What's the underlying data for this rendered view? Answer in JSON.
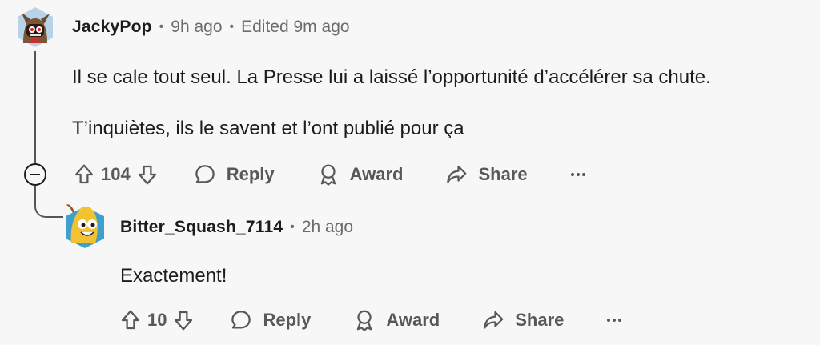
{
  "comments": [
    {
      "username": "JackyPop",
      "time": "9h ago",
      "edited": "Edited 9m ago",
      "body": [
        "Il se cale tout seul. La Presse lui a laissé l’opportunité d’accélérer sa chute.",
        "T’inquiètes, ils le savent et l’ont publié pour ça"
      ],
      "score": "104"
    },
    {
      "username": "Bitter_Squash_7114",
      "time": "2h ago",
      "body": [
        "Exactement!"
      ],
      "score": "10"
    }
  ],
  "actions": {
    "reply": "Reply",
    "award": "Award",
    "share": "Share"
  },
  "colors": {
    "background": "#f7f7f8",
    "text": "#1c1c1c",
    "muted": "#6a6d70",
    "avatar1_bg": "#b8d3e8",
    "avatar2_bg": "#3fa0d0"
  }
}
